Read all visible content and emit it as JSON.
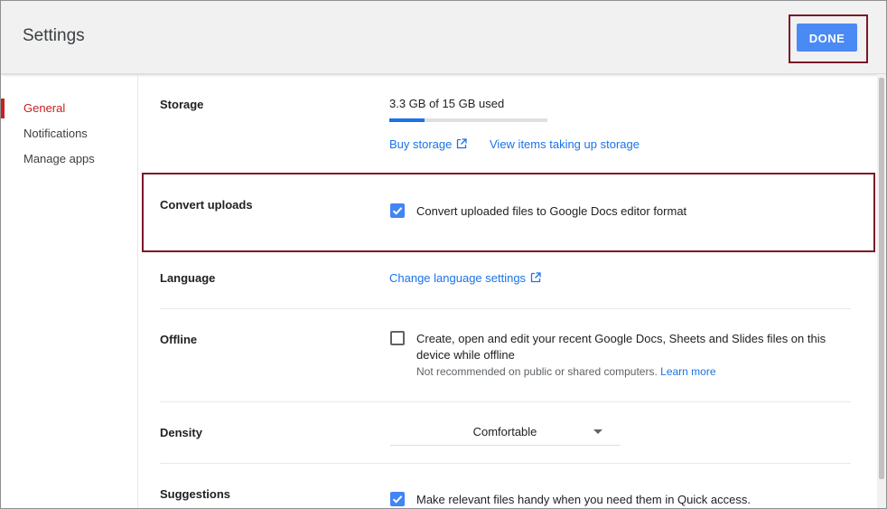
{
  "header": {
    "title": "Settings",
    "done_label": "DONE"
  },
  "nav": {
    "items": [
      {
        "label": "General",
        "active": true
      },
      {
        "label": "Notifications",
        "active": false
      },
      {
        "label": "Manage apps",
        "active": false
      }
    ]
  },
  "storage": {
    "label": "Storage",
    "usage_text": "3.3 GB of 15 GB used",
    "usage_fraction": 0.22,
    "buy_link": "Buy storage",
    "view_link": "View items taking up storage"
  },
  "convert_uploads": {
    "label": "Convert uploads",
    "checkbox_label": "Convert uploaded files to Google Docs editor format",
    "checked": true
  },
  "language": {
    "label": "Language",
    "link": "Change language settings"
  },
  "offline": {
    "label": "Offline",
    "checkbox_label_line1": "Create, open and edit your recent Google Docs, Sheets and Slides files on this",
    "checkbox_label_line2": "device while offline",
    "note": "Not recommended on public or shared computers.",
    "learn_more": "Learn more",
    "checked": false
  },
  "density": {
    "label": "Density",
    "selected": "Comfortable"
  },
  "suggestions": {
    "label": "Suggestions",
    "checkbox_label": "Make relevant files handy when you need them in Quick access.",
    "checked": true
  },
  "colors": {
    "accent_blue": "#1a73e8",
    "button_blue": "#4a8af4",
    "active_red": "#c5221f",
    "highlight_border": "#7b1728"
  }
}
